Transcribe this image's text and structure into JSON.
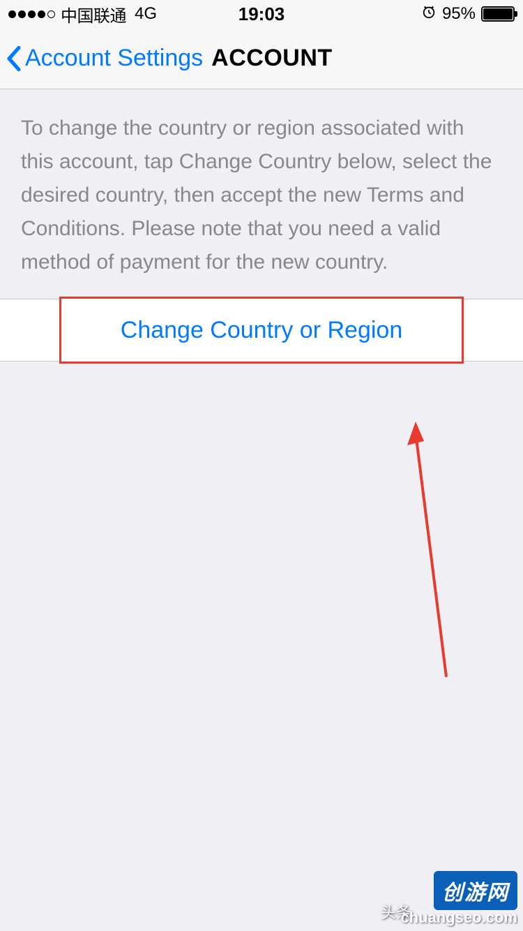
{
  "status_bar": {
    "carrier": "中国联通",
    "network": "4G",
    "time": "19:03",
    "battery_percent": "95%"
  },
  "nav": {
    "back_label": "Account Settings",
    "title": "ACCOUNT"
  },
  "body": {
    "description": "To change the country or region associated with this account, tap Change Country below, select the desired country, then accept the new Terms and Conditions. Please note that you need a valid method of payment for the new country.",
    "change_button_label": "Change Country or Region"
  },
  "watermark": {
    "toutiao": "头条",
    "badge": "创游网",
    "url": "chuangseo.com"
  }
}
